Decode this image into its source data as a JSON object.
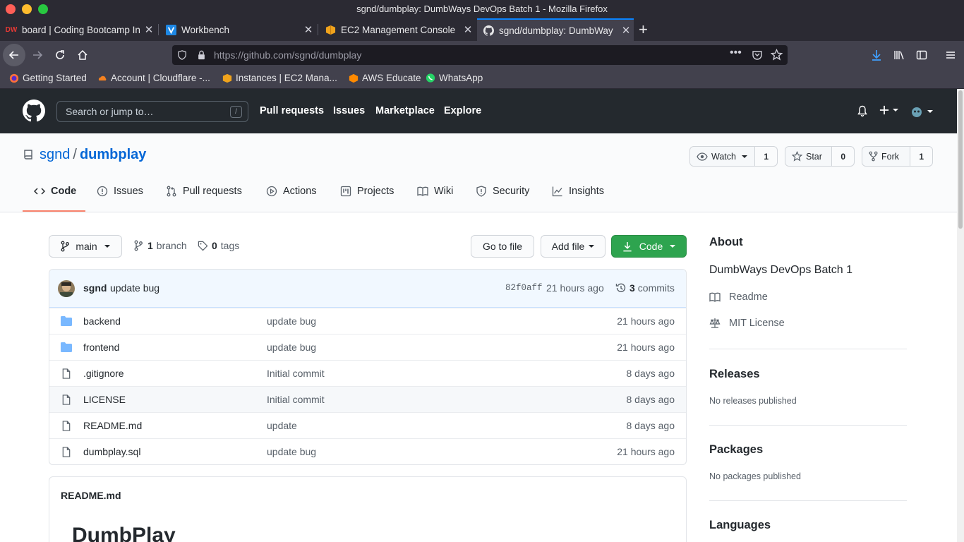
{
  "window": {
    "title": "sgnd/dumbplay: DumbWays DevOps Batch 1 - Mozilla Firefox"
  },
  "tabs": [
    {
      "label": "board | Coding Bootcamp In",
      "icon": "dumbways-favicon"
    },
    {
      "label": "Workbench",
      "icon": "vultr-favicon"
    },
    {
      "label": "EC2 Management Console",
      "icon": "aws-favicon"
    },
    {
      "label": "sgnd/dumbplay: DumbWay",
      "icon": "github-favicon"
    }
  ],
  "urlbar": {
    "value": "https://github.com/sgnd/dumbplay"
  },
  "bookmarks": [
    {
      "label": "Getting Started",
      "icon": "firefox-icon"
    },
    {
      "label": "Account | Cloudflare -...",
      "icon": "cloudflare-icon"
    },
    {
      "label": "Instances | EC2 Mana...",
      "icon": "aws-icon"
    },
    {
      "label": "AWS Educate",
      "icon": "aws-educate-icon"
    },
    {
      "label": "WhatsApp",
      "icon": "whatsapp-icon"
    }
  ],
  "gh_header": {
    "search_placeholder": "Search or jump to…",
    "slash_key": "/",
    "nav": [
      "Pull requests",
      "Issues",
      "Marketplace",
      "Explore"
    ]
  },
  "repo": {
    "owner": "sgnd",
    "separator": "/",
    "name": "dumbplay",
    "watch": {
      "label": "Watch",
      "count": "1"
    },
    "star": {
      "label": "Star",
      "count": "0"
    },
    "fork": {
      "label": "Fork",
      "count": "1"
    },
    "tabs": [
      "Code",
      "Issues",
      "Pull requests",
      "Actions",
      "Projects",
      "Wiki",
      "Security",
      "Insights"
    ]
  },
  "toolbar": {
    "branch": "main",
    "branch_count": "1",
    "branch_label": "branch",
    "tag_count": "0",
    "tag_label": "tags",
    "goto_file": "Go to file",
    "add_file": "Add file",
    "code": "Code"
  },
  "commit": {
    "author": "sgnd",
    "message": "update bug",
    "sha": "82f0aff",
    "age": "21 hours ago",
    "count": "3",
    "count_label": "commits"
  },
  "files": [
    {
      "type": "dir",
      "name": "backend",
      "message": "update bug",
      "age": "21 hours ago"
    },
    {
      "type": "dir",
      "name": "frontend",
      "message": "update bug",
      "age": "21 hours ago"
    },
    {
      "type": "file",
      "name": ".gitignore",
      "message": "Initial commit",
      "age": "8 days ago"
    },
    {
      "type": "file",
      "name": "LICENSE",
      "message": "Initial commit",
      "age": "8 days ago"
    },
    {
      "type": "file",
      "name": "README.md",
      "message": "update",
      "age": "8 days ago"
    },
    {
      "type": "file",
      "name": "dumbplay.sql",
      "message": "update bug",
      "age": "21 hours ago"
    }
  ],
  "readme": {
    "filename": "README.md",
    "heading": "DumbPlay"
  },
  "about": {
    "heading": "About",
    "description": "DumbWays DevOps Batch 1",
    "readme_link": "Readme",
    "license_link": "MIT License"
  },
  "releases": {
    "heading": "Releases",
    "sub": "No releases published"
  },
  "packages": {
    "heading": "Packages",
    "sub": "No packages published"
  },
  "languages": {
    "heading": "Languages"
  },
  "colors": {
    "accent": "#0366d6",
    "green": "#2ea44f",
    "tab_underline": "#f9826c",
    "firefox_blue": "#0a84ff"
  }
}
